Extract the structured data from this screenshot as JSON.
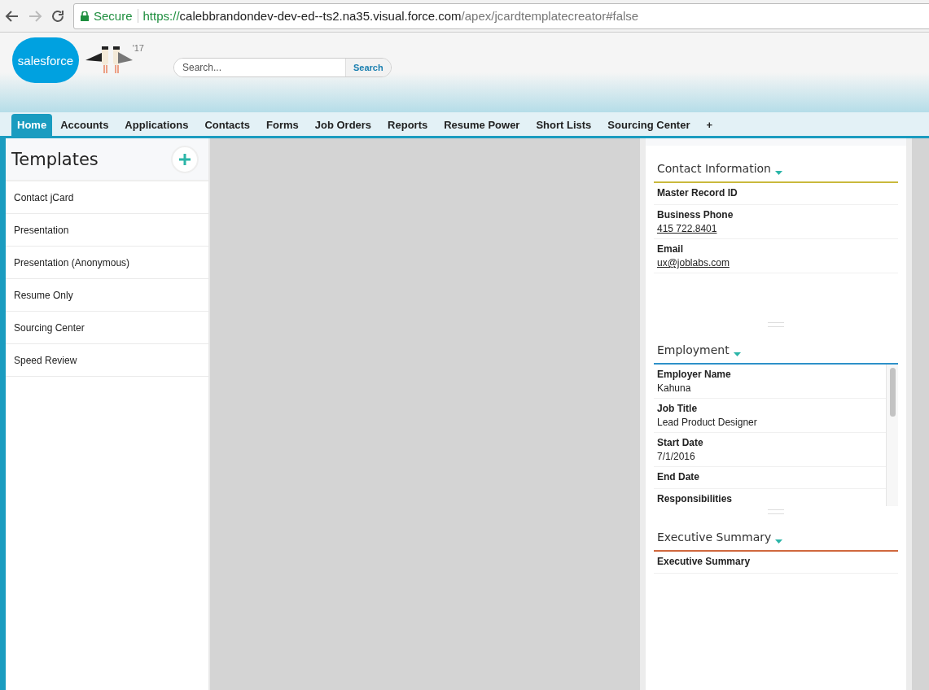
{
  "browser": {
    "secure_label": "Secure",
    "url": {
      "scheme": "https://",
      "host": "calebbrandondev-dev-ed--ts2.na35.visual.force.com",
      "path": "/apex/jcardtemplatecreator#false"
    }
  },
  "header": {
    "logo": "salesforce",
    "badge": "'17",
    "search": {
      "placeholder": "Search...",
      "button": "Search"
    }
  },
  "tabs": [
    {
      "label": "Home",
      "selected": true
    },
    {
      "label": "Accounts",
      "selected": false
    },
    {
      "label": "Applications",
      "selected": false
    },
    {
      "label": "Contacts",
      "selected": false
    },
    {
      "label": "Forms",
      "selected": false
    },
    {
      "label": "Job Orders",
      "selected": false
    },
    {
      "label": "Reports",
      "selected": false
    },
    {
      "label": "Resume Power",
      "selected": false
    },
    {
      "label": "Short Lists",
      "selected": false
    },
    {
      "label": "Sourcing Center",
      "selected": false
    },
    {
      "label": "+",
      "selected": false
    }
  ],
  "templates": {
    "title": "Templates",
    "items": [
      "Contact jCard",
      "Presentation",
      "Presentation (Anonymous)",
      "Resume Only",
      "Sourcing Center",
      "Speed Review"
    ]
  },
  "sections": [
    {
      "title": "Contact Information",
      "color": "#c9b93c",
      "scrollable": false,
      "fields": [
        {
          "label": "Master Record ID"
        },
        {
          "label": "Business Phone",
          "value": "415 722.8401",
          "link": true
        },
        {
          "label": "Email",
          "value": "ux@joblabs.com",
          "link": true
        }
      ]
    },
    {
      "title": "Employment",
      "color": "#2e91c9",
      "scrollable": true,
      "fields": [
        {
          "label": "Employer Name",
          "value": "Kahuna",
          "link": false
        },
        {
          "label": "Job Title",
          "value": "Lead Product Designer",
          "link": false
        },
        {
          "label": "Start Date",
          "value": "7/1/2016",
          "link": false
        },
        {
          "label": "End Date"
        },
        {
          "label": "Responsibilities"
        }
      ]
    },
    {
      "title": "Executive Summary",
      "color": "#d0683e",
      "scrollable": false,
      "fields": [
        {
          "label": "Executive Summary"
        }
      ]
    }
  ]
}
